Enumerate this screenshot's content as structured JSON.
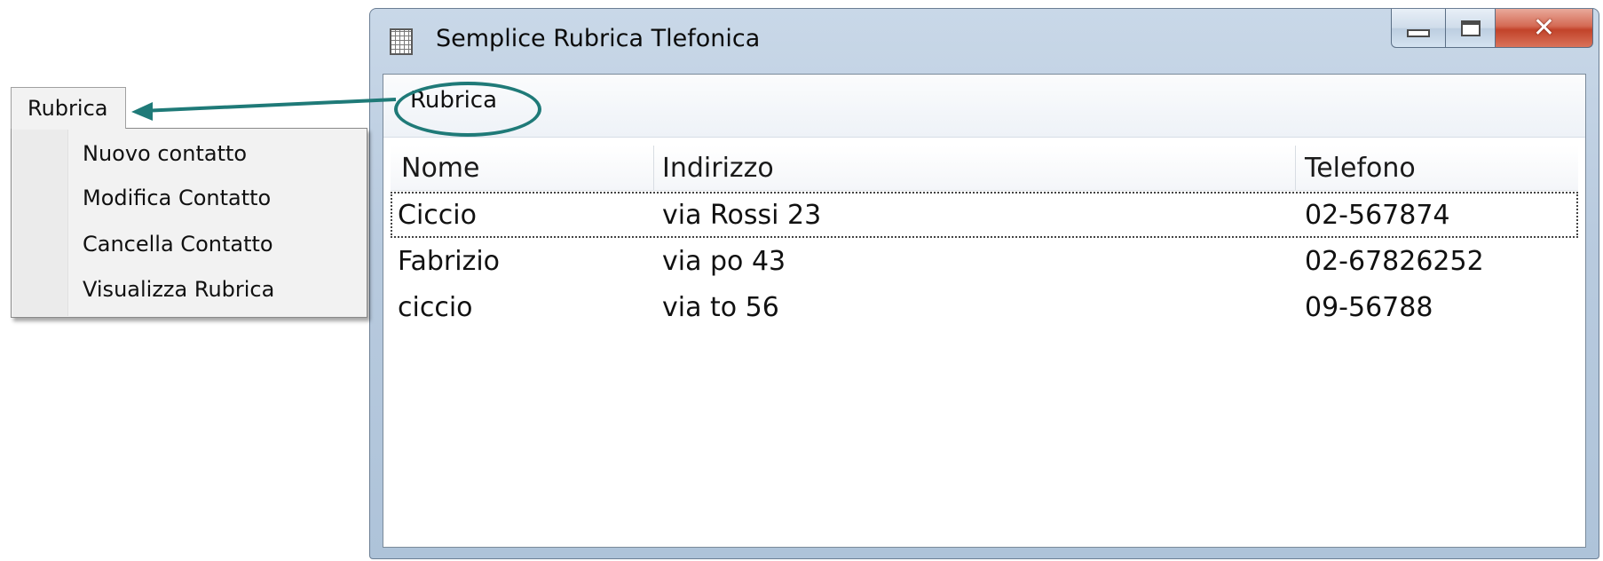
{
  "floating_menu": {
    "title": "Rubrica",
    "items": [
      {
        "label": "Nuovo contatto"
      },
      {
        "label": "Modifica Contatto"
      },
      {
        "label": "Cancella Contatto"
      },
      {
        "label": "Visualizza Rubrica"
      }
    ]
  },
  "window": {
    "title": "Semplice Rubrica Tlefonica",
    "icon": "notepad-icon",
    "menubar": {
      "items": [
        {
          "label": "Rubrica"
        }
      ]
    },
    "list": {
      "columns": [
        "Nome",
        "Indirizzo",
        "Telefono"
      ],
      "rows": [
        {
          "nome": "Ciccio",
          "indirizzo": "via Rossi 23",
          "telefono": "02-567874",
          "selected": true
        },
        {
          "nome": "Fabrizio",
          "indirizzo": "via po 43",
          "telefono": "02-67826252",
          "selected": false
        },
        {
          "nome": "ciccio",
          "indirizzo": "via to 56",
          "telefono": "09-56788",
          "selected": false
        }
      ]
    }
  },
  "colors": {
    "annotation": "#1f7a78",
    "close_button": "#c2432a",
    "window_frame": "#b9cbdf"
  }
}
